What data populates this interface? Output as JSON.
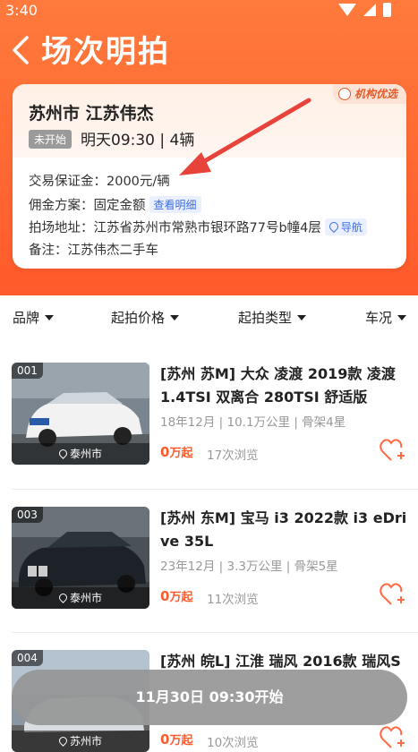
{
  "status_bar": {
    "time": "3:40"
  },
  "header": {
    "title": "场次明拍"
  },
  "auction": {
    "badge": "机构优选",
    "title": "苏州市 江苏伟杰",
    "status_tag": "未开始",
    "time_count": "明天09:30 | 4辆",
    "deposit": "交易保证金：2000元/辆",
    "commission_label": "佣金方案：固定金额",
    "commission_link": "查看明细",
    "address": "拍场地址：江苏省苏州市常熟市银环路77号b幢4层",
    "navigate": "导航",
    "remark": "备注：江苏伟杰二手车"
  },
  "filters": [
    "品牌",
    "起拍价格",
    "起拍类型",
    "车况"
  ],
  "listings": [
    {
      "index": "001",
      "location": "泰州市",
      "title": "[苏州 苏M] 大众 凌渡 2019款 凌渡 1.4TSI 双离合 280TSI 舒适版",
      "meta": "18年12月 | 10.1万公里 | 骨架4星",
      "price": "0",
      "price_unit": "万起",
      "views": "17次浏览"
    },
    {
      "index": "003",
      "location": "泰州市",
      "title": "[苏州 东M] 宝马 i3 2022款 i3 eDrive 35L",
      "meta": "23年12月 | 3.3万公里 | 骨架5星",
      "price": "0",
      "price_unit": "万起",
      "views": "11次浏览"
    },
    {
      "index": "004",
      "location": "苏州市",
      "title": "[苏州 皖L] 江淮 瑞风 2016款 瑞风S",
      "meta": "",
      "price": "0",
      "price_unit": "万起",
      "views": "10次浏览"
    }
  ],
  "start_button": "11月30日 09:30开始",
  "colors": {
    "accent": "#ff5a2b",
    "header_gradient_top": "#ff7a3c",
    "link": "#3b6ce0"
  }
}
